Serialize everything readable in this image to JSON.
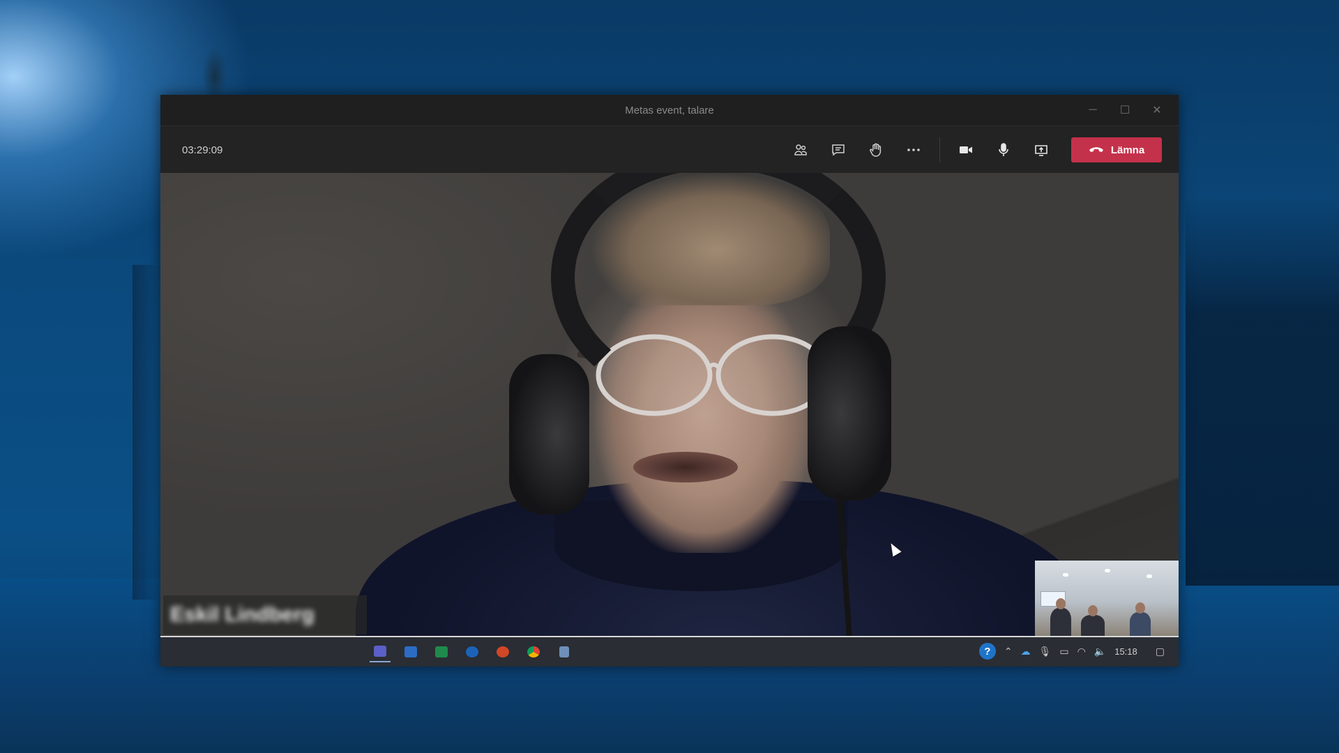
{
  "window": {
    "title": "Metas event, talare",
    "controls": [
      "minimize-icon",
      "maximize-icon",
      "close-icon"
    ]
  },
  "callbar": {
    "timer": "03:29:09",
    "tools": [
      "people-icon",
      "chat-icon",
      "raise-hand-icon",
      "more-icon",
      "camera-icon",
      "microphone-icon",
      "share-screen-icon"
    ],
    "leave_label": "Lämna",
    "leave_color": "#c4314b"
  },
  "video": {
    "participant_name": "Eskil Lindberg"
  },
  "taskbar": {
    "apps": [
      "teams",
      "word",
      "excel",
      "outlook",
      "powerpoint",
      "chrome",
      "notepad"
    ],
    "clock": "15:18"
  }
}
